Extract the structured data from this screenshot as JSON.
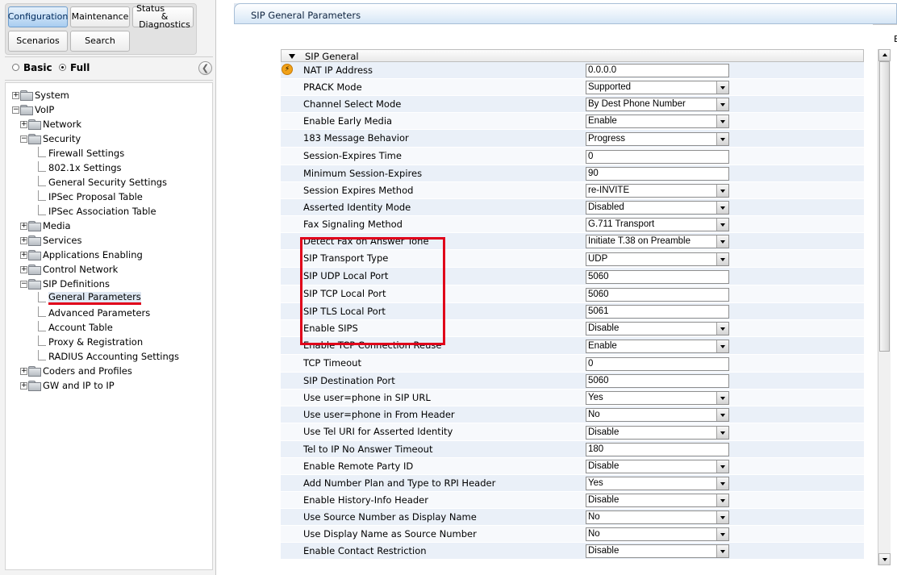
{
  "nav": {
    "configuration": "Configuration",
    "maintenance": "Maintenance",
    "status_line1": "Status",
    "status_line2": "& Diagnostics",
    "scenarios": "Scenarios",
    "search": "Search"
  },
  "mode": {
    "basic": "Basic",
    "full": "Full",
    "selected": "Full"
  },
  "tree": [
    {
      "label": "System",
      "kind": "folder",
      "expander": "+",
      "indent": 0
    },
    {
      "label": "VoIP",
      "kind": "folder",
      "expander": "-",
      "indent": 0
    },
    {
      "label": "Network",
      "kind": "folder",
      "expander": "+",
      "indent": 1
    },
    {
      "label": "Security",
      "kind": "folder",
      "expander": "-",
      "indent": 1
    },
    {
      "label": "Firewall Settings",
      "kind": "page",
      "indent": 2
    },
    {
      "label": "802.1x Settings",
      "kind": "page",
      "indent": 2
    },
    {
      "label": "General Security Settings",
      "kind": "page",
      "indent": 2
    },
    {
      "label": "IPSec Proposal Table",
      "kind": "page",
      "indent": 2
    },
    {
      "label": "IPSec Association Table",
      "kind": "page",
      "indent": 2
    },
    {
      "label": "Media",
      "kind": "folder",
      "expander": "+",
      "indent": 1
    },
    {
      "label": "Services",
      "kind": "folder",
      "expander": "+",
      "indent": 1
    },
    {
      "label": "Applications Enabling",
      "kind": "folder",
      "expander": "+",
      "indent": 1
    },
    {
      "label": "Control Network",
      "kind": "folder",
      "expander": "+",
      "indent": 1
    },
    {
      "label": "SIP Definitions",
      "kind": "folder",
      "expander": "-",
      "indent": 1
    },
    {
      "label": "General Parameters",
      "kind": "page",
      "indent": 2,
      "selected": true
    },
    {
      "label": "Advanced Parameters",
      "kind": "page",
      "indent": 2
    },
    {
      "label": "Account Table",
      "kind": "page",
      "indent": 2
    },
    {
      "label": "Proxy & Registration",
      "kind": "page",
      "indent": 2
    },
    {
      "label": "RADIUS Accounting Settings",
      "kind": "page",
      "indent": 2
    },
    {
      "label": "Coders and Profiles",
      "kind": "folder",
      "expander": "+",
      "indent": 1
    },
    {
      "label": "GW and IP to IP",
      "kind": "folder",
      "expander": "+",
      "indent": 1
    }
  ],
  "page": {
    "title": "SIP General Parameters",
    "edge_text": "E",
    "section": "SIP General"
  },
  "params": [
    {
      "label": "NAT IP Address",
      "type": "text",
      "value": "0.0.0.0"
    },
    {
      "label": "PRACK Mode",
      "type": "select",
      "value": "Supported"
    },
    {
      "label": "Channel Select Mode",
      "type": "select",
      "value": "By Dest Phone Number"
    },
    {
      "label": "Enable Early Media",
      "type": "select",
      "value": "Enable"
    },
    {
      "label": "183 Message Behavior",
      "type": "select",
      "value": "Progress"
    },
    {
      "label": "Session-Expires Time",
      "type": "text",
      "value": "0"
    },
    {
      "label": "Minimum Session-Expires",
      "type": "text",
      "value": "90"
    },
    {
      "label": "Session Expires Method",
      "type": "select",
      "value": "re-INVITE"
    },
    {
      "label": "Asserted Identity Mode",
      "type": "select",
      "value": "Disabled"
    },
    {
      "label": "Fax Signaling Method",
      "type": "select",
      "value": "G.711 Transport"
    },
    {
      "label": "Detect Fax on Answer Tone",
      "type": "select",
      "value": "Initiate T.38 on Preamble"
    },
    {
      "label": "SIP Transport Type",
      "type": "select",
      "value": "UDP"
    },
    {
      "label": "SIP UDP Local Port",
      "type": "text",
      "value": "5060"
    },
    {
      "label": "SIP TCP Local Port",
      "type": "text",
      "value": "5060"
    },
    {
      "label": "SIP TLS Local Port",
      "type": "text",
      "value": "5061"
    },
    {
      "label": "Enable SIPS",
      "type": "select",
      "value": "Disable"
    },
    {
      "label": "Enable TCP Connection Reuse",
      "type": "select",
      "value": "Enable"
    },
    {
      "label": "TCP Timeout",
      "type": "text",
      "value": "0"
    },
    {
      "label": "SIP Destination Port",
      "type": "text",
      "value": "5060"
    },
    {
      "label": "Use user=phone in SIP URL",
      "type": "select",
      "value": "Yes"
    },
    {
      "label": "Use user=phone in From Header",
      "type": "select",
      "value": "No"
    },
    {
      "label": "Use Tel URI for Asserted Identity",
      "type": "select",
      "value": "Disable"
    },
    {
      "label": "Tel to IP No Answer Timeout",
      "type": "text",
      "value": "180"
    },
    {
      "label": "Enable Remote Party ID",
      "type": "select",
      "value": "Disable"
    },
    {
      "label": "Add Number Plan and Type to RPI Header",
      "type": "select",
      "value": "Yes"
    },
    {
      "label": "Enable History-Info Header",
      "type": "select",
      "value": "Disable"
    },
    {
      "label": "Use Source Number as Display Name",
      "type": "select",
      "value": "No"
    },
    {
      "label": "Use Display Name as Source Number",
      "type": "select",
      "value": "No"
    },
    {
      "label": "Enable Contact Restriction",
      "type": "select",
      "value": "Disable"
    }
  ],
  "icons": {
    "nat_marker": "lightning-icon"
  },
  "colors": {
    "highlight": "#e0001a",
    "active_tab": "#a9cdf0"
  }
}
